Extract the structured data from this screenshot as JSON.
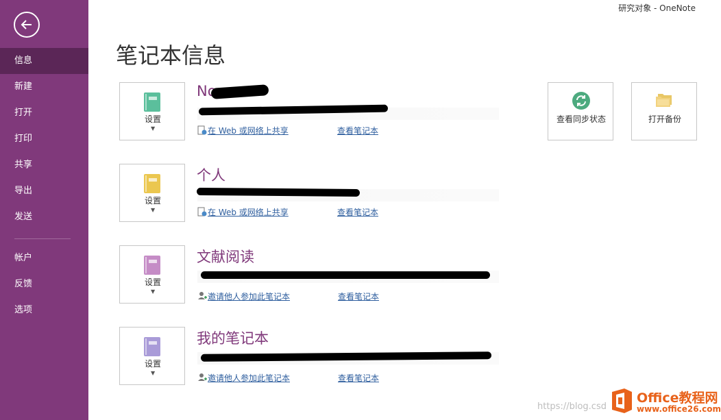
{
  "window": {
    "title": "研究对象  -  OneNote"
  },
  "sidebar": {
    "items": [
      {
        "label": "信息"
      },
      {
        "label": "新建"
      },
      {
        "label": "打开"
      },
      {
        "label": "打印"
      },
      {
        "label": "共享"
      },
      {
        "label": "导出"
      },
      {
        "label": "发送"
      },
      {
        "label": "帐户"
      },
      {
        "label": "反馈"
      },
      {
        "label": "选项"
      }
    ]
  },
  "page": {
    "title": "笔记本信息"
  },
  "notebooks": [
    {
      "name": "No",
      "settings_label": "设置",
      "link1": "在 Web 或网络上共享",
      "link2": "查看笔记本",
      "color": "#5BBF9C"
    },
    {
      "name": "个人",
      "settings_label": "设置",
      "link1": "在 Web 或网络上共享",
      "link2": "查看笔记本",
      "color": "#EBC74F"
    },
    {
      "name": "文献阅读",
      "settings_label": "设置",
      "link1": "邀请他人参加此笔记本",
      "link2": "查看笔记本",
      "color": "#C58CC6"
    },
    {
      "name": "我的笔记本",
      "settings_label": "设置",
      "link1": "邀请他人参加此笔记本",
      "link2": "查看笔记本",
      "color": "#A99BD8"
    }
  ],
  "actions": {
    "sync_label": "查看同步状态",
    "backup_label": "打开备份"
  },
  "watermark": {
    "url": "https://blog.csd",
    "brand": "Office教程网",
    "site": "www.office26.com"
  },
  "colors": {
    "sidebar": "#80397B",
    "sidebar_active": "#5B2657",
    "accent": "#80397B",
    "link": "#2E5E9E"
  }
}
